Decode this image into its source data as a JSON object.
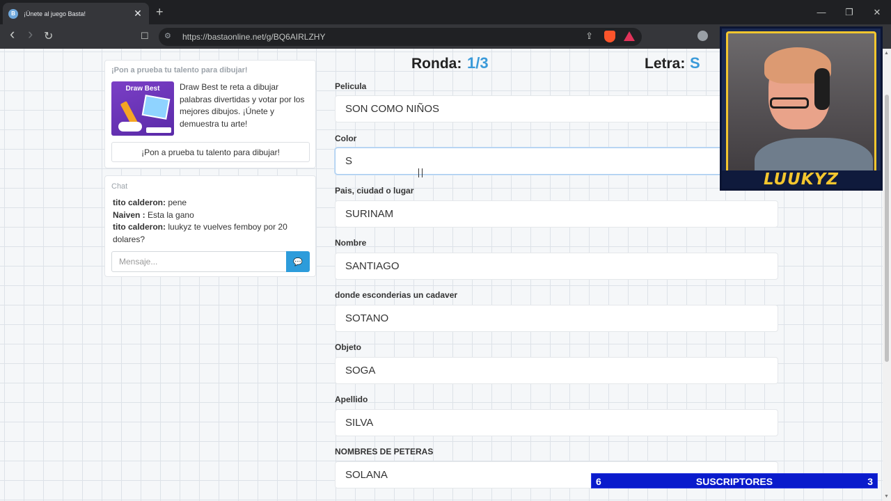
{
  "browser": {
    "tab_title": "¡Únete al juego Basta!",
    "tab_close": "✕",
    "new_tab": "+",
    "url": "https://bastaonline.net/g/BQ6AIRLZHY",
    "window_controls": [
      "—",
      "❐",
      "✕"
    ],
    "nav": {
      "back": "‹",
      "forward": "›",
      "reload": "↻",
      "bookmark": "☐"
    }
  },
  "promo": {
    "heading": "¡Pon a prueba tu talento para dibujar!",
    "image_title": "Draw Best",
    "text": "Draw Best te reta a dibujar palabras divertidas y votar por los mejores dibujos. ¡Únete y demuestra tu arte!",
    "button": "¡Pon a prueba tu talento para dibujar!"
  },
  "chat": {
    "heading": "Chat",
    "messages": [
      {
        "user": "tito calderon:",
        "text": " pene"
      },
      {
        "user": "Naiven :",
        "text": " Esta la gano"
      },
      {
        "user": "tito calderon:",
        "text": " luukyz te vuelves femboy por 20 dolares?"
      }
    ],
    "input_placeholder": "Mensaje...",
    "send_icon": "💬"
  },
  "game": {
    "round_label": "Ronda:",
    "round_value": "1/3",
    "letter_label": "Letra:",
    "letter_value": "S",
    "fields": [
      {
        "label": "Pelicula",
        "value": "SON COMO NIÑOS"
      },
      {
        "label": "Color",
        "value": "S"
      },
      {
        "label": "Pais, ciudad o lugar",
        "value": "SURINAM"
      },
      {
        "label": "Nombre",
        "value": "SANTIAGO"
      },
      {
        "label": "donde esconderias un cadaver",
        "value": "SOTANO"
      },
      {
        "label": "Objeto",
        "value": "SOGA"
      },
      {
        "label": "Apellido",
        "value": "SILVA"
      },
      {
        "label": "NOMBRES DE PETERAS",
        "value": "SOLANA"
      }
    ]
  },
  "overlay": {
    "webcam_name": "LUUKYZ",
    "subs_left": "6",
    "subs_label": "SUSCRIPTORES",
    "subs_right": "3"
  },
  "colors": {
    "accent": "#3a9ad9",
    "send_button": "#2d9cdb",
    "subs_bar": "#0a1bcc",
    "webcam_gold": "#f4c62e"
  }
}
